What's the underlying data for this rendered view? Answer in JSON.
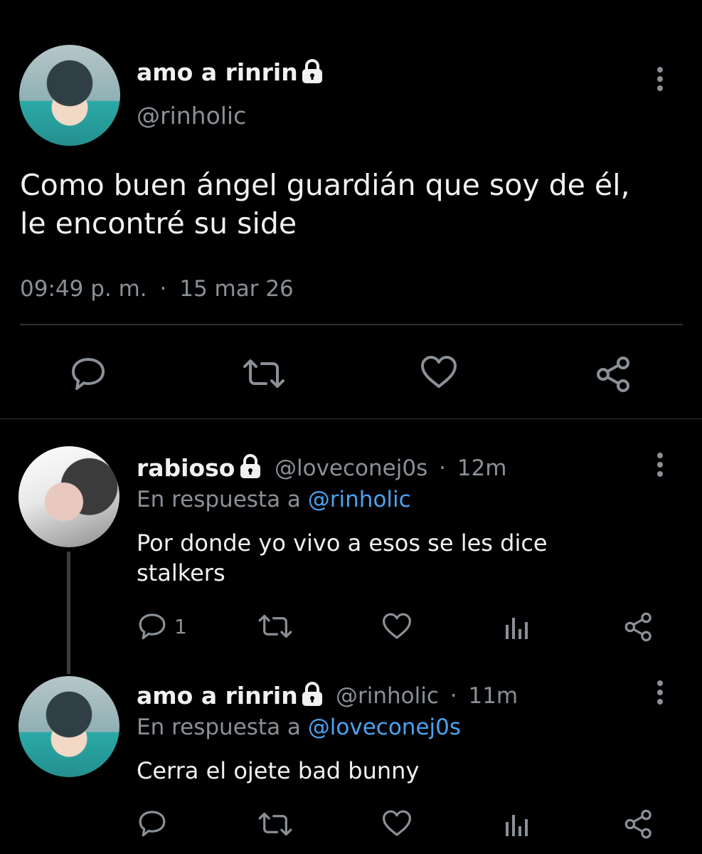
{
  "main_tweet": {
    "display_name": "amo a rinrin",
    "handle": "@rinholic",
    "text_line1": "Como buen ángel guardián que soy de él,",
    "text_line2": "le encontré su side",
    "time": "09:49 p. m.",
    "separator": "·",
    "date": "15 mar 26"
  },
  "replies": [
    {
      "display_name": "rabioso",
      "handle": "@loveconej0s",
      "separator": "·",
      "age": "12m",
      "reply_prefix": "En respuesta a",
      "reply_to": "@rinholic",
      "text_line1": "Por donde yo vivo a esos se les dice",
      "text_line2": "stalkers",
      "reply_count": "1"
    },
    {
      "display_name": "amo a rinrin",
      "handle": "@rinholic",
      "separator": "·",
      "age": "11m",
      "reply_prefix": "En respuesta a",
      "reply_to": "@loveconej0s",
      "text_line1": "Cerra el ojete bad bunny"
    }
  ],
  "colors": {
    "background": "#000000",
    "text": "#e7e9ea",
    "muted": "#8a9097",
    "link": "#4aa3f0",
    "divider": "#2f3336"
  },
  "icons": [
    "lock-icon",
    "more-options-icon",
    "reply-icon",
    "retweet-icon",
    "like-icon",
    "share-icon",
    "analytics-icon"
  ]
}
